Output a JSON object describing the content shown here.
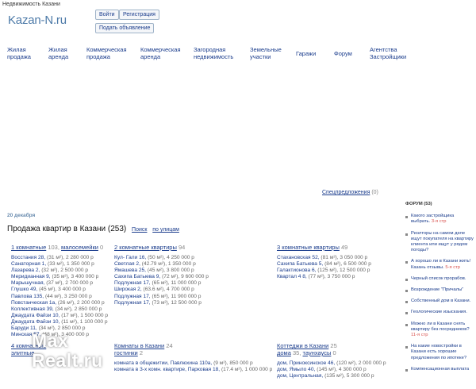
{
  "header": {
    "topline": "Недвижимость Казани",
    "logo": "Kazan-N.ru",
    "buttons": {
      "login": "Войти",
      "register": "Регистрация",
      "post_ad": "Подать объявление"
    }
  },
  "nav": [
    [
      "Жилая",
      "продажа"
    ],
    [
      "Жилая",
      "аренда"
    ],
    [
      "Коммерческая",
      "продажа"
    ],
    [
      "Коммерческая",
      "аренда"
    ],
    [
      "Загородная",
      "недвижимость"
    ],
    [
      "Земельные",
      "участки"
    ],
    [
      "Гаражи",
      ""
    ],
    [
      "Форум",
      ""
    ],
    [
      "Агентства",
      "Застройщики"
    ]
  ],
  "special_offers": {
    "label": "Спецпредложения",
    "count": "(0)"
  },
  "date": "20 декабря",
  "page_title": {
    "text": "Продажа квартир в Казани",
    "count": "(253)",
    "search": "Поиск",
    "by_streets": "по улицам"
  },
  "sections": {
    "one_room": {
      "title": "1 комнатные",
      "count": "103,",
      "extra_label": "малосемейки",
      "extra_count": "0",
      "rows": [
        [
          "Восстания 28,",
          "(31 м²),",
          "2 280 000 р"
        ],
        [
          "Санаторная 1,",
          "(33 м²),",
          "1 350 000 р"
        ],
        [
          "Лазарева 2,",
          "(32 м²),",
          "2 500 000 р"
        ],
        [
          "Меридианная 9,",
          "(35 м²),",
          "3 400 000 р"
        ],
        [
          "Марышучная,",
          "(37 м²),",
          "2 700 000 р"
        ],
        [
          "Глушко 49,",
          "(45 м²),",
          "3 400 000 р"
        ],
        [
          "Павлова 135,",
          "(44 м²),",
          "3 250 000 р"
        ],
        [
          "Повстанческая 1а,",
          "(26 м²),",
          "2 200 000 р"
        ],
        [
          "Коллективная 39,",
          "(34 м²),",
          "2 850 000 р"
        ],
        [
          "Джаудата Файзи 10,",
          "(17 м²),",
          "1 500 000 р"
        ],
        [
          "Джаудата Файзи 10,",
          "(11 м²),",
          "1 100 000 р"
        ],
        [
          "Баруди 11,",
          "(34 м²),",
          "2 850 000 р"
        ],
        [
          "Минская 57,",
          "(48 м²),",
          "3 400 000 р"
        ]
      ]
    },
    "two_room": {
      "title": "2 комнатные квартиры",
      "count": "94",
      "rows": [
        [
          "Кул- Гали 16,",
          "(50 м²),",
          "4 250 000 р"
        ],
        [
          "Светлая 2,",
          "(42.79 м²),",
          "1 350 000 р"
        ],
        [
          "Ямашева 25,",
          "(45 м²),",
          "3 800 000 р"
        ],
        [
          "Сахипа Батыева 9,",
          "(72 м²),",
          "9 600 000 р"
        ],
        [
          "Подлужная 17,",
          "(65 м²),",
          "11 000 000 р"
        ],
        [
          "Широкая 2,",
          "(63.6 м²),",
          "4 700 000 р"
        ],
        [
          "Подлужная 17,",
          "(65 м²),",
          "11 900 000 р"
        ],
        [
          "Подлужная 17,",
          "(73 м²),",
          "12 500 000 р"
        ]
      ]
    },
    "three_room": {
      "title": "3 комнатные квартиры",
      "count": "49",
      "rows": [
        [
          "Стахановская 52,",
          "(81 м²),",
          "3 050 000 р"
        ],
        [
          "Сахипа Батыева 5,",
          "(84 м²),",
          "6 500 000 р"
        ],
        [
          "Галактионова 6,",
          "(125 м²),",
          "12 500 000 р"
        ],
        [
          "Квартал 4 8,",
          "(77 м²),",
          "3 750 000 р"
        ]
      ]
    },
    "four_room": {
      "title": "4 комнатные",
      "line2": "элитные"
    },
    "rooms": {
      "title": "Комнаты в Казани",
      "count": "24",
      "sub": "гостинки",
      "sub_count": "2",
      "rows": [
        [
          "комната в общежитии, Павлюхина 110а,",
          "(9 м²),",
          "850 000 р"
        ],
        [
          "комната в 3-х комн. квартире, Парковая 18,",
          "(17.4 м²),",
          "1 000 000 р"
        ]
      ]
    },
    "cottages": {
      "title": "Коттеджи в Казани",
      "count": "25",
      "sub": "дома",
      "sub_count": "35,",
      "sub2": "таунхаусы",
      "sub2_count": "0",
      "rows": [
        [
          "дом, Приноксинское 46,",
          "(120 м²),",
          "2 000 000 р"
        ],
        [
          "дом, Ямыло 40,",
          "(145 м²),",
          "4 300 000 р"
        ],
        [
          "дом, Центральная,",
          "(135 м²),",
          "5 300 000 р"
        ]
      ]
    }
  },
  "sidebar": {
    "head": "ФОРУМ (53)",
    "items": [
      {
        "text": "Какого застройщика выбрать.",
        "tag": "3-я стр"
      },
      {
        "text": "Риэлторы на самом деле ищут покупателя на квартиру клиента или ищут у рядом погоды?",
        "tag": ""
      },
      {
        "text": "А хорошо ли в Казани жить! Казань отзывы.",
        "tag": "5-я стр"
      },
      {
        "text": "Черный список прорабов.",
        "tag": ""
      },
      {
        "text": "Возрождение \"Причалы\"",
        "tag": ""
      },
      {
        "text": "Собственный дом в Казани.",
        "tag": ""
      },
      {
        "text": "Геологические изыскания.",
        "tag": ""
      },
      {
        "text": "Можно ли в Казани снять квартиру без посредников?",
        "tag": "11-я стр"
      },
      {
        "text": "На какие новостройки в Казани есть хорошие предложения по ипотеке?",
        "tag": ""
      },
      {
        "text": "Компенсационная выплата",
        "tag": ""
      }
    ]
  },
  "watermark": {
    "line1": "Max",
    "line2": "Realt.ru"
  }
}
